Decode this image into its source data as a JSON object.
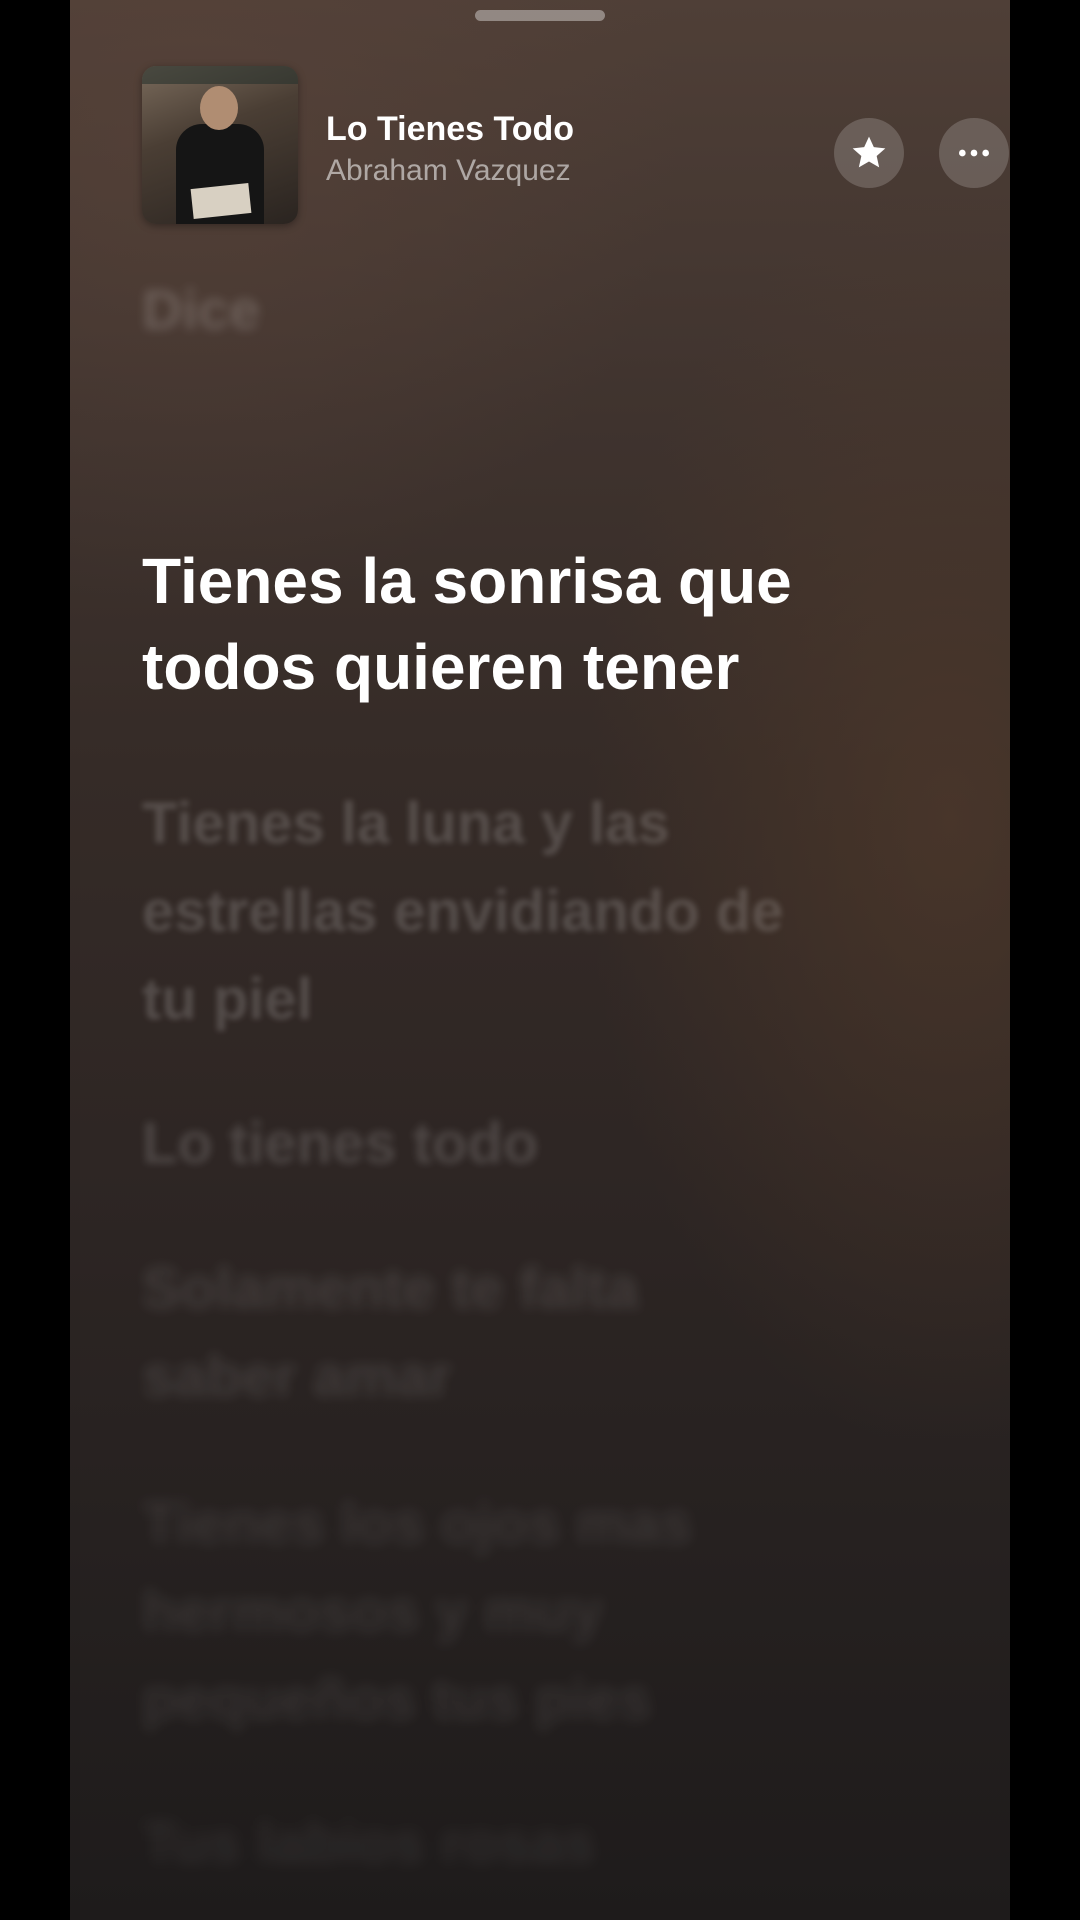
{
  "now_playing": {
    "title": "Lo Tienes Todo",
    "artist": "Abraham Vazquez",
    "artwork_icon": "album-artwork",
    "favorite_icon": "star-icon",
    "more_icon": "ellipsis-icon"
  },
  "lyrics": {
    "previous": [
      "Dice"
    ],
    "current": [
      "Tienes la sonrisa que",
      "todos quieren tener"
    ],
    "upcoming": [
      [
        "Tienes la luna y las",
        "estrellas envidiando de",
        "tu piel"
      ],
      [
        "Lo tienes todo"
      ],
      [
        "Solamente te falta",
        "saber amar"
      ],
      [
        "Tienes los ojos mas",
        "hermosos y muy",
        "pequeños tus pies"
      ],
      [
        "Tus labios rosas"
      ]
    ]
  },
  "colors": {
    "accent": "#ffffff",
    "background_top": "#4f3f37",
    "background_bottom": "#1e1b1b"
  }
}
